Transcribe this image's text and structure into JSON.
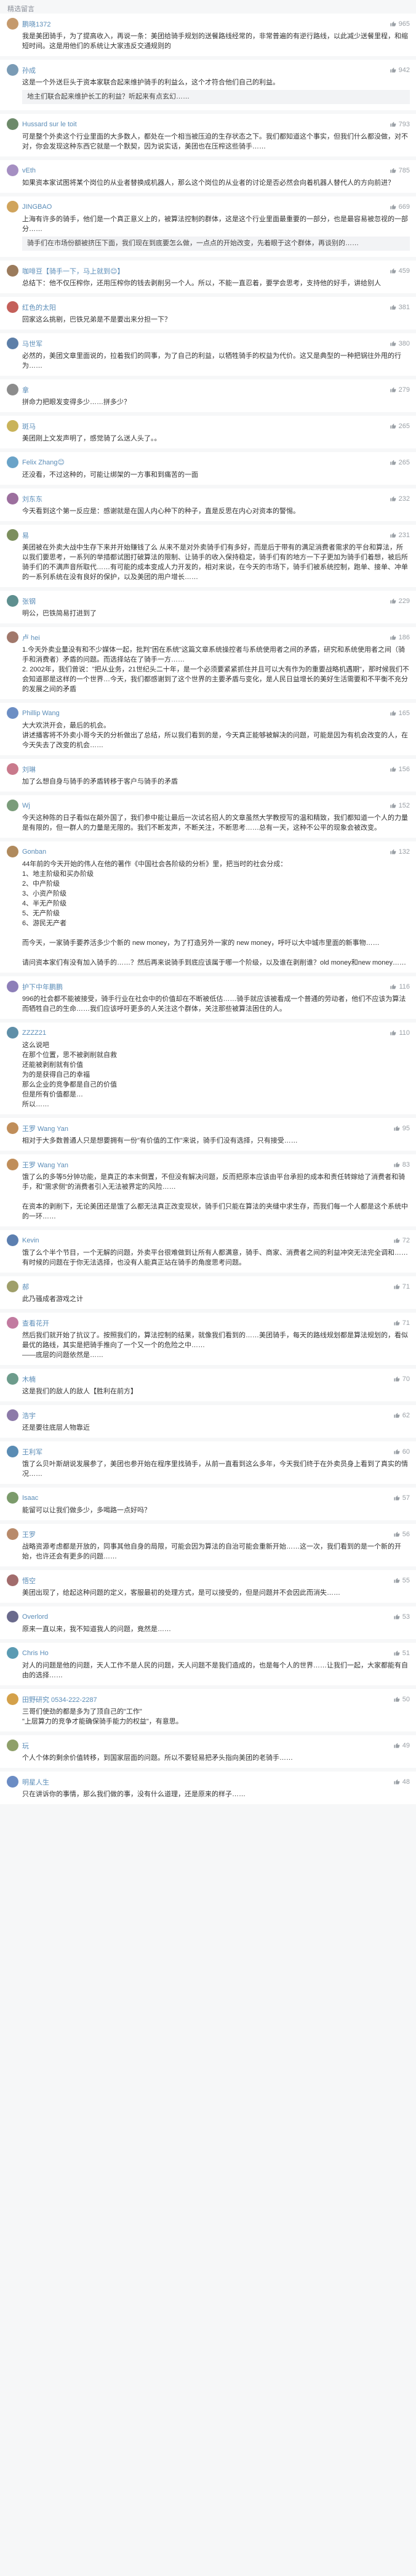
{
  "header": {
    "title": "精选留言"
  },
  "comments": [
    {
      "user": "鹏晓1372",
      "likes": "965",
      "color": "#c59a6d",
      "text": "我是美团骑手，为了提高收入，再说一条：美团给骑手规划的送餐路线经常的，非常普遍的有逆行路线，以此减少送餐里程，和缩短时间。这是用他们的系统让大家违反交通规则的"
    },
    {
      "user": "孙成",
      "likes": "942",
      "color": "#7a9bb5",
      "text": "这是一个外送巨头于资本家联合起来维护骑手的利益么，这个才符合他们自己的利益。",
      "quote_author": "",
      "quote": "地主们联合起来维护长工的利益？听起来有点玄幻……"
    },
    {
      "user": "Hussard sur le toit",
      "likes": "793",
      "color": "#6d8a6a",
      "text": "可是整个外卖这个行业里面的大多数人，都处在一个相当被压迫的生存状态之下。我们都知道这个事实，但我们什么都没做，对不对，你会发现这种东西它就是一个默契，因为说实话，美团也在压榨这些骑手……"
    },
    {
      "user": "vEth",
      "likes": "785",
      "color": "#a58fc2",
      "text": "如果资本家试图将某个岗位的从业者替换成机器人，那么这个岗位的从业者的讨论是否必然会向着机器人替代人的方向前进？"
    },
    {
      "user": "JINGBAO",
      "likes": "669",
      "color": "#d0a45c",
      "text": "上海有许多的骑手，他们是一个真正意义上的，被算法控制的群体，这是这个行业里面最重要的一部分，也是最容易被忽视的一部分……",
      "quote_author": "",
      "quote": "骑手们在市场份额被挤压下面，我们现在到底要怎么做，一点点的开始改变，先着眼于这个群体，再谈别的……"
    },
    {
      "user": "咖啡豆【骑手一下，马上就到😊】",
      "likes": "459",
      "color": "#9b7b5c",
      "text": "总结下：他不仅压榨你，还用压榨你的钱去剥削另一个人。所以，不能一直忍着，要学会思考，支持他的好手，讲给别人"
    },
    {
      "user": "红色的太阳",
      "likes": "381",
      "color": "#c4605a",
      "text": "回家这么挑剔，巴铁兄弟是不是要出来分担一下？"
    },
    {
      "user": "马世军",
      "likes": "380",
      "color": "#5d7fa8",
      "text": "必然的，美团文章里面说的，拉着我们的同事，为了自己的利益，以牺牲骑手的权益为代价。这又是典型的一种把锅往外甩的行为……"
    },
    {
      "user": "拿",
      "likes": "279",
      "color": "#8c8c8c",
      "text": "拼命力把眼发变得多少……拼多少？"
    },
    {
      "user": "斑马",
      "likes": "265",
      "color": "#c9b35a",
      "text": "美团刚上文发声明了，感觉骑了么送人头了。。"
    },
    {
      "user": "Felix Zhang😊",
      "likes": "265",
      "color": "#6aa3c8",
      "text": "还没看，不过这种的，可能让绑架的一方事和到痛苦的一面"
    },
    {
      "user": "刘东东",
      "likes": "232",
      "color": "#9c6f9e",
      "text": "今天看到这个第一反应是：感谢就是在国人内心种下的种子，直是反思在内心对资本的警惕。"
    },
    {
      "user": "易",
      "likes": "231",
      "color": "#7c8f5d",
      "text": "美团被在外卖大战中生存下来并开始赚钱了么 从来不是对外卖骑手们有多好，而是后于带有的满足消费者需求的平台和算法，所以我们要思考，一系列的举措都试图打破算法的限制、让骑手的收入保持稳定，骑手们有的地方一下子更加为骑手们着想，被后所骑手们的不满声音所取代……有可能的成本变成人力开发的，相对来说，在今天的市场下，骑手们被系统控制，跑单、接单、冲单的一系列系统在没有良好的保护，以及美团的用户增长……"
    },
    {
      "user": "张钢",
      "likes": "229",
      "color": "#5e8f8f",
      "text": "明公，巴铁简易打进到了"
    },
    {
      "user": "卢 hei",
      "likes": "186",
      "color": "#a1786b",
      "text": "1.今天外卖业量没有和不少媒体一起，批判\"困在系统\"这篇文章系统操控者与系统使用者之间的矛盾，研究和系统使用者之间（骑手和消费者）矛盾的问题。而选择站在了骑手一方……\n2. 2002年，我们曾说：\"把从业务，21世纪头二十年，是一个必须要紧紧抓住并且可以大有作为的重要战略机遇期\"，那时候我们不会知道那是这样的一个世界…今天，我们都感谢到了这个世界的主要矛盾与变化，是人民日益增长的美好生活需要和不平衡不充分的发展之间的矛盾"
    },
    {
      "user": "Phillip Wang",
      "likes": "165",
      "color": "#6c8ec4",
      "text": "大大欢洪开会，最后的机会。\n讲述播客将不外卖小哥今天的分析做出了总结，所以我们看到的是，今天真正能够被解决的问题，可能是因为有机会改变的人，在今天失去了改变的机会……"
    },
    {
      "user": "刘琳",
      "likes": "156",
      "color": "#c97a8c",
      "text": "加了么想自身与骑手的矛盾转移于客户与骑手的矛盾"
    },
    {
      "user": "Wj",
      "likes": "152",
      "color": "#7a9c7a",
      "text": "今天这种陈的日子看似在颠外国了，我们参中能让最后一次试名招人的文章虽然大学教授写的温和精致，我们都知道一个人的力量是有限的，但一群人的力量是无限的。我们不断发声，不断关注，不断思考……总有一天，这种不公平的现象会被改变。"
    },
    {
      "user": "Gonban",
      "likes": "132",
      "color": "#b08a5d",
      "text": "44年前的今天开始的伟人在他的著作《中国社会各阶级的分析》里，把当时的社会分成：\n1、地主阶级和买办阶级\n2、中产阶级\n3、小资产阶级\n4、半无产阶级\n5、无产阶级\n6、游民无产者\n\n而今天，一家骑手要养活多少个新的 new money，为了打造另外一家的 new money，呼吁以大中城市里面的新事物……\n\n请问资本家们有没有加入骑手的……？然后再来说骑手到底应该属于哪一个阶级，以及谁在剥削谁？old money和new money……"
    },
    {
      "user": "护下中年鹏鹏",
      "likes": "116",
      "color": "#8d7fb8",
      "text": "996的社会都不能被接受，骑手行业在社会中的价值却在不断被低估……骑手就应该被看成一个普通的劳动者，他们不应该为算法而牺牲自己的生命……我们应该呼吁更多的人关注这个群体，关注那些被算法困住的人。"
    },
    {
      "user": "ZZZZ21",
      "likes": "110",
      "color": "#5f8fa8",
      "text": "这么说吧\n在那个位置，思不被剥削就自救\n还能被剥削就有价值\n为的是获得自己的幸福\n那么企业的竞争都是自己的价值\n但是所有价值都是…\n所以……"
    },
    {
      "user": "王罗 Wang Yan",
      "likes": "95",
      "color": "#c08e5a",
      "text": "相对于大多数普通人只是想要拥有一份\"有价值的工作\"来说，骑手们没有选择，只有接受……"
    },
    {
      "user": "王罗 Wang Yan",
      "likes": "83",
      "color": "#c08e5a",
      "text": "饿了么的多等5分钟功能，是真正的本末倒置，不但没有解决问题，反而把原本应该由平台承担的成本和责任转嫁给了消费者和骑手，和\"需求侧\"的消费者引入无法被界定的风险……\n\n在资本的剥削下，无论美团还是饿了么都无法真正改变现状，骑手们只能在算法的夹缝中求生存，而我们每一个人都是这个系统中的一环……"
    },
    {
      "user": "Kevin",
      "likes": "72",
      "color": "#5c7fb0",
      "text": "饿了么个半个节目，一个无解的问题，外卖平台很难做到让所有人都满意，骑手、商家、消费者之间的利益冲突无法完全调和……有时候的问题在于你无法选择，也没有人能真正站在骑手的角度思考问题。"
    },
    {
      "user": "郝",
      "likes": "71",
      "color": "#9f9f6a",
      "text": "此乃骚成者游戏之计"
    },
    {
      "user": "查看花开",
      "likes": "71",
      "color": "#c27ba0",
      "text": "然后我们就开始了抗议了。按照我们的，算法控制的结果，就像我们看到的……美团骑手，每天的路线规划都是算法规划的，看似最优的路线，其实是把骑手推向了一个又一个的危险之中……\n——底层的问题依然是……"
    },
    {
      "user": "木楠",
      "likes": "70",
      "color": "#6d9c8c",
      "text": "这是我们的敌人的敌人【胜利在前方】"
    },
    {
      "user": "浩宇",
      "likes": "62",
      "color": "#8c7aa8",
      "text": "还是要往底层人物靠近"
    },
    {
      "user": "王利军",
      "likes": "60",
      "color": "#5a8cb4",
      "text": "饿了么贝叶斯胡说发展参了，美团也参开始在程序里找骑手，从前一直看到这么多年，今天我们终于在外卖员身上看到了真实的情况……"
    },
    {
      "user": "Isaac",
      "likes": "57",
      "color": "#7b9b6b",
      "text": "能留可以让我们做多少，多喝路一点好吗？"
    },
    {
      "user": "王罗",
      "likes": "56",
      "color": "#b88a6a",
      "text": "战略资源考虑都是开放的，同事其他自身的局限，可能会因为算法的自治可能会重新开始……这一次，我们看到的是一个新的开始，也许还会有更多的问题……"
    },
    {
      "user": "悟空",
      "likes": "55",
      "color": "#a26c6c",
      "text": "美团出现了，给起这种问题的定义，客服最初的处理方式，是可以接受的，但是问题并不会因此而消失……"
    },
    {
      "user": "Overlord",
      "likes": "53",
      "color": "#6a6a8c",
      "text": "原来一直以来，我不知道我人的问题，竟然是……"
    },
    {
      "user": "Chris Ho",
      "likes": "51",
      "color": "#5b9bb3",
      "text": "对人的问题是他的问题，天人工作不是人民的问题，天人问题不是我们造成的，也是每个人的世界……让我们一起，大家都能有自由的选择……"
    },
    {
      "user": "田野研究 0534-222-2287",
      "likes": "50",
      "color": "#d4a14a",
      "text": "三哥们使劲的都是多为了顶自己的\"工作\"\n\"上层算力的竞争才能确保骑手能力的权益\"，有意思。"
    },
    {
      "user": "玩",
      "likes": "49",
      "color": "#8fa06a",
      "text": "个人个体的剩余价值转移，到国家层面的问题。所以不要轻易把矛头指向美团的老骑手……"
    },
    {
      "user": "明星人生",
      "likes": "48",
      "color": "#6b8cc4",
      "text": "只在讲诉你的事情，那么我们做的事，没有什么道理，还是原来的样子……"
    }
  ]
}
